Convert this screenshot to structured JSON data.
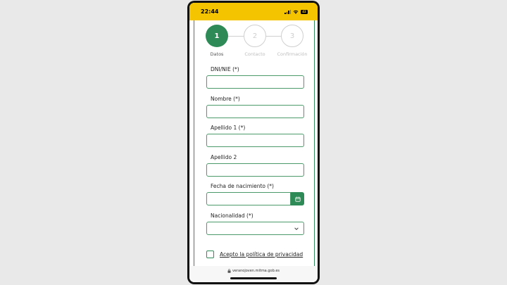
{
  "status_bar": {
    "time": "22:44",
    "battery": "42"
  },
  "stepper": {
    "steps": [
      {
        "number": "1",
        "label": "Datos"
      },
      {
        "number": "2",
        "label": "Contacto"
      },
      {
        "number": "3",
        "label": "Confirmación"
      }
    ]
  },
  "form": {
    "dni_label": "DNI/NIE (*)",
    "dni_value": "",
    "nombre_label": "Nombre (*)",
    "nombre_value": "",
    "apellido1_label": "Apellido 1 (*)",
    "apellido1_value": "",
    "apellido2_label": "Apellido 2",
    "apellido2_value": "",
    "fecha_label": "Fecha de nacimiento (*)",
    "fecha_value": "",
    "nacionalidad_label": "Nacionalidad (*)",
    "nacionalidad_value": "",
    "privacy_label": "Acepto la política de privacidad"
  },
  "browser": {
    "url": "veranojoven.mitma.gob.es"
  },
  "colors": {
    "accent": "#2e8b57",
    "status_bar": "#f5c400"
  },
  "icons": [
    "calendar-icon",
    "chevron-down-icon",
    "lock-icon",
    "wifi-icon",
    "battery-icon",
    "signal-icon"
  ]
}
